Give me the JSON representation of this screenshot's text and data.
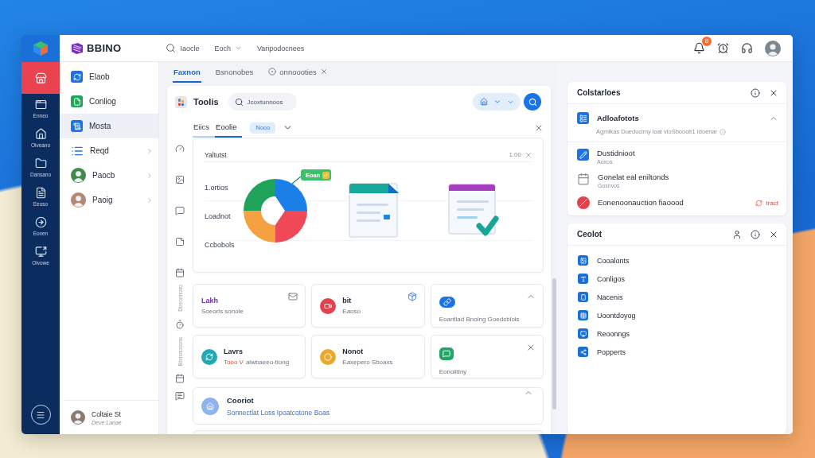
{
  "rail": {
    "items": [
      {
        "selected": true
      },
      {
        "label": "Enneo",
        "selected": false
      },
      {
        "label": "Oiveano",
        "selected": false
      },
      {
        "label": "Dansano",
        "selected": false
      },
      {
        "label": "Eeoso",
        "selected": false
      },
      {
        "label": "Eoxen",
        "selected": false
      },
      {
        "label": "Oivowe",
        "selected": false
      }
    ]
  },
  "topbar": {
    "brand": "BBINO",
    "search_label": "Iaocle",
    "menu_label": "Eoch",
    "link": "Varipodocnees",
    "notification_count": "8"
  },
  "sidebar": {
    "items": [
      {
        "kind": "icon",
        "label": "Elaob",
        "selected": false,
        "expandable": false
      },
      {
        "kind": "icon",
        "label": "Conliog",
        "selected": false,
        "expandable": false
      },
      {
        "kind": "icon",
        "label": "Mosta",
        "selected": true,
        "expandable": false
      },
      {
        "kind": "icon",
        "label": "Reqd",
        "selected": false,
        "expandable": true
      },
      {
        "kind": "avatar",
        "label": "Paocb",
        "selected": false,
        "expandable": true
      },
      {
        "kind": "avatar",
        "label": "Paoig",
        "selected": false,
        "expandable": true
      }
    ],
    "user": {
      "name": "Coltaie St",
      "role": "Deve Lanae"
    }
  },
  "tabs": [
    {
      "label": "Faxnon",
      "selected": true,
      "closable": false
    },
    {
      "label": "Bsnonobes",
      "selected": false,
      "closable": false
    },
    {
      "label": "onnoooties",
      "selected": false,
      "closable": true
    }
  ],
  "tools": {
    "title": "Toolis",
    "search": {
      "placeholder": "Jcoxtunnoos"
    },
    "subtabs": [
      {
        "label": "Eiics",
        "selected": false
      },
      {
        "label": "Eoolie",
        "selected": true
      }
    ],
    "chip": "Nooo",
    "side_labels": [
      "Dbeonnono",
      "Bbnsnonons"
    ],
    "overview": {
      "title": "Yaltutst",
      "time": "1:00",
      "rows": [
        "1.ortios",
        "Loadnot",
        "Ccbobols"
      ],
      "tag": "Eoan"
    },
    "cards": [
      {
        "kind": "text",
        "title": "Lakh",
        "subtitle": "Soeorls sonole",
        "color": "#6b2fb8"
      },
      {
        "kind": "row",
        "title": "bit",
        "subtitle": "Eaoso",
        "color": "#e5404d"
      },
      {
        "kind": "stack",
        "subtitle": "Eoantlad Bnoing Goedcblols",
        "color": "#1a73e8"
      },
      {
        "kind": "row",
        "title": "Lavrs",
        "highlight": "Tooo V",
        "subtitle": "aiwbaeeo-tiong",
        "color": "#22a9b8"
      },
      {
        "kind": "row",
        "title": "Nonot",
        "subtitle": "Eaxepero Sboaxs",
        "color": "#e9a92b"
      },
      {
        "kind": "stack",
        "subtitle": "Eonolitiny",
        "color": "#22a565"
      }
    ],
    "wide_card": {
      "title": "Cooriot",
      "subtitle": "Sonnectlat Loss Ipoatcotone Boas"
    }
  },
  "right_panel": {
    "alerts": {
      "title": "Colstarloes",
      "section": {
        "title": "Adloafotots",
        "description": "Agrnikas Duedocimy loat vloSbooob1 Idoenar",
        "expanded": true
      },
      "items": [
        {
          "title": "Dustidnioot",
          "subtitle": "Aoxos"
        },
        {
          "title": "Gonelat eal eniltonds",
          "subtitle": "Gosnvos"
        },
        {
          "title": "Eonenoonauction fiaoood",
          "action": "tract"
        }
      ]
    },
    "list": {
      "title": "Ceolot",
      "items": [
        "Cooalonts",
        "Conligos",
        "Nacenis",
        "Uoontdoyog",
        "Reoonngs",
        "Popperts"
      ]
    }
  }
}
